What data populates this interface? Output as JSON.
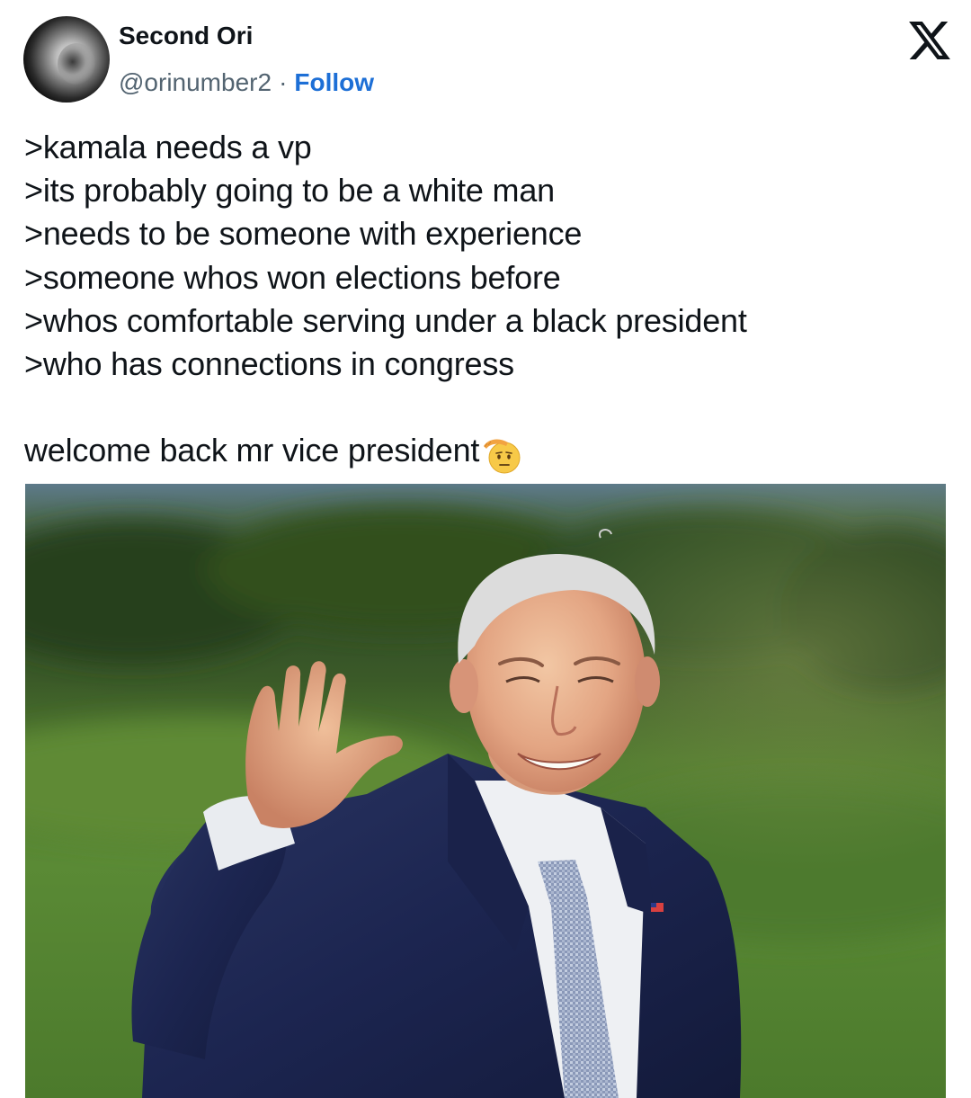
{
  "author": {
    "display_name": "Second Ori",
    "handle": "@orinumber2",
    "separator": "·",
    "follow_label": "Follow"
  },
  "platform": {
    "logo_icon": "x-logo-icon"
  },
  "tweet": {
    "lines": [
      ">kamala needs a vp",
      ">its probably going to be a white man",
      ">needs to be someone with experience",
      ">someone whos won elections before",
      ">whos comfortable serving under a black president",
      ">who has connections in congress"
    ],
    "closing": "welcome back mr vice president",
    "closing_emoji": "saluting-face-icon"
  },
  "media": {
    "icon": "photo-waving-man-icon"
  },
  "colors": {
    "follow_link": "#1d6fd6",
    "handle_gray": "#536471",
    "text": "#0f1419"
  }
}
